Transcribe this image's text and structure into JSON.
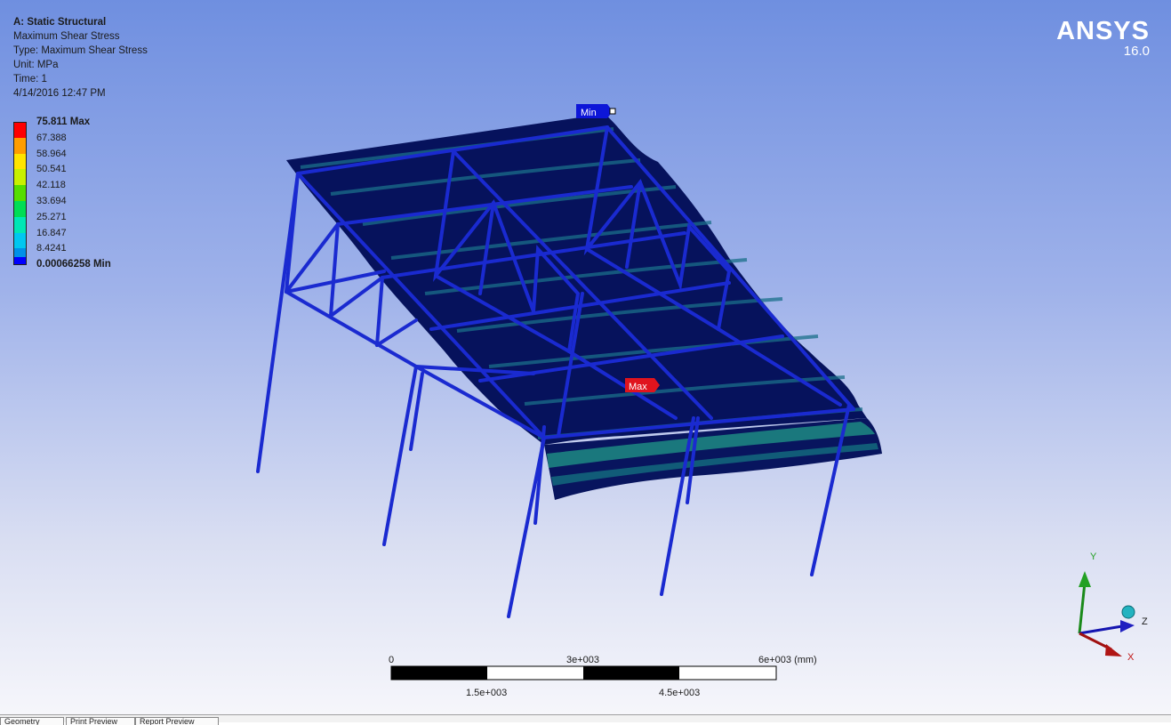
{
  "analysis": {
    "title": "A: Static Structural",
    "result": "Maximum Shear Stress",
    "type": "Type: Maximum Shear Stress",
    "unit": "Unit: MPa",
    "time": "Time: 1",
    "date": "4/14/2016 12:47 PM"
  },
  "logo": {
    "name": "ANSYS",
    "version": "16.0"
  },
  "legend": {
    "entries": [
      {
        "label": "75.811 Max",
        "color": "#ff0000",
        "bold": true
      },
      {
        "label": "67.388",
        "color": "#ff9d00",
        "bold": false
      },
      {
        "label": "58.964",
        "color": "#ffe400",
        "bold": false
      },
      {
        "label": "50.541",
        "color": "#c8f000",
        "bold": false
      },
      {
        "label": "42.118",
        "color": "#55dd00",
        "bold": false
      },
      {
        "label": "33.694",
        "color": "#00dd55",
        "bold": false
      },
      {
        "label": "25.271",
        "color": "#00e6b5",
        "bold": false
      },
      {
        "label": "16.847",
        "color": "#00c7f0",
        "bold": false
      },
      {
        "label": "8.4241",
        "color": "#0090e8",
        "bold": false
      },
      {
        "label": "0.00066258 Min",
        "color": "#0000ff",
        "bold": true
      }
    ]
  },
  "probes": {
    "min_label": "Min",
    "max_label": "Max"
  },
  "scale_bar": {
    "top_labels": [
      "0",
      "3e+003",
      "6e+003 (mm)"
    ],
    "bottom_labels": [
      "1.5e+003",
      "4.5e+003"
    ]
  },
  "triad": {
    "x": "X",
    "y": "Y",
    "z": "Z"
  },
  "tabs": [
    "Geometry",
    "Print Preview",
    "Report Preview"
  ],
  "colors": {
    "frame": "#1626c8",
    "panel": "#05115a",
    "min_tag": "#0d16d8",
    "max_tag": "#e0141e"
  }
}
